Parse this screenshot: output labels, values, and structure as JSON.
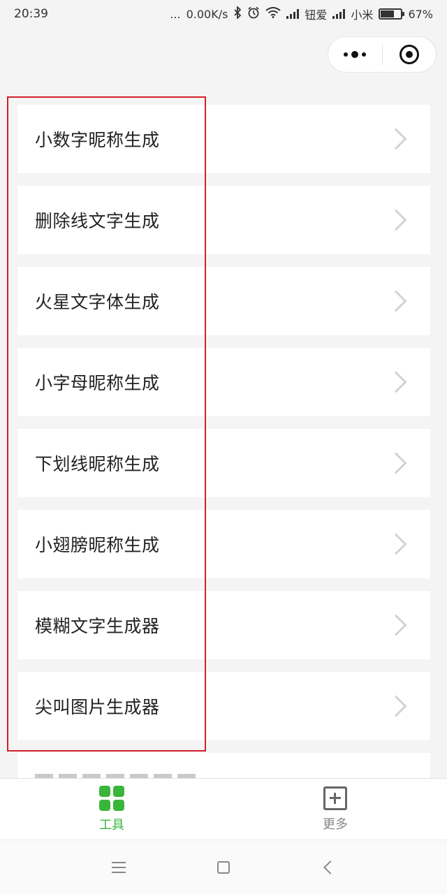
{
  "status_bar": {
    "time": "20:39",
    "dots": "...",
    "network_speed": "0.00K/s",
    "carrier1": "钮爱",
    "carrier2": "小米",
    "battery": "67%",
    "battery_level": 0.67
  },
  "list": {
    "items": [
      {
        "label": "小数字昵称生成"
      },
      {
        "label": "删除线文字生成"
      },
      {
        "label": "火星文字体生成"
      },
      {
        "label": "小字母昵称生成"
      },
      {
        "label": "下划线昵称生成"
      },
      {
        "label": "小翅膀昵称生成"
      },
      {
        "label": "模糊文字生成器"
      },
      {
        "label": "尖叫图片生成器"
      }
    ]
  },
  "tab_bar": {
    "tabs": [
      {
        "label": "工具",
        "icon": "grid-icon",
        "active": true
      },
      {
        "label": "更多",
        "icon": "plus-icon",
        "active": false
      }
    ]
  },
  "colors": {
    "accent": "#3ab53a",
    "highlight": "#d0202a"
  }
}
